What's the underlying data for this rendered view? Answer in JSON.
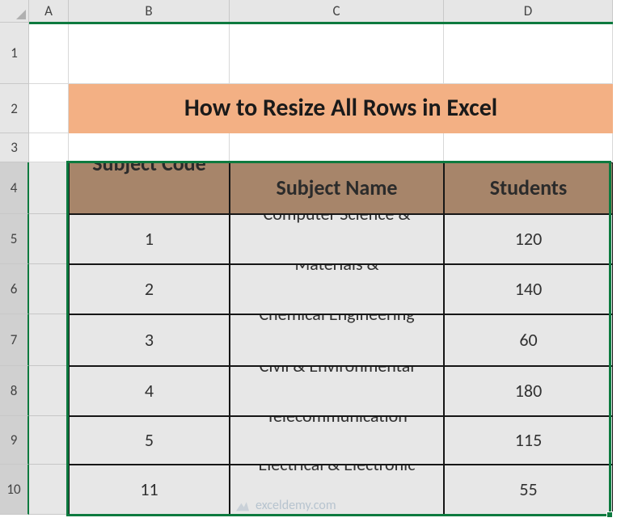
{
  "columns": [
    "A",
    "B",
    "C",
    "D"
  ],
  "rows": [
    "1",
    "2",
    "3",
    "4",
    "5",
    "6",
    "7",
    "8",
    "9",
    "10"
  ],
  "title": "How to Resize All Rows in Excel",
  "table": {
    "headers": {
      "B": "Subject Code",
      "C": "Subject Name",
      "D": "Students"
    },
    "data": [
      {
        "code": "1",
        "name": "Computer Science &",
        "students": "120"
      },
      {
        "code": "2",
        "name": "Materials &",
        "students": "140"
      },
      {
        "code": "3",
        "name": "Chemical Engineering",
        "students": "60"
      },
      {
        "code": "4",
        "name": "Civil & Environmental",
        "students": "180"
      },
      {
        "code": "5",
        "name": "Telecommunication",
        "students": "115"
      },
      {
        "code": "11",
        "name": "Electrical & Electronic",
        "students": "55"
      }
    ]
  },
  "watermark": "exceldemy.com"
}
